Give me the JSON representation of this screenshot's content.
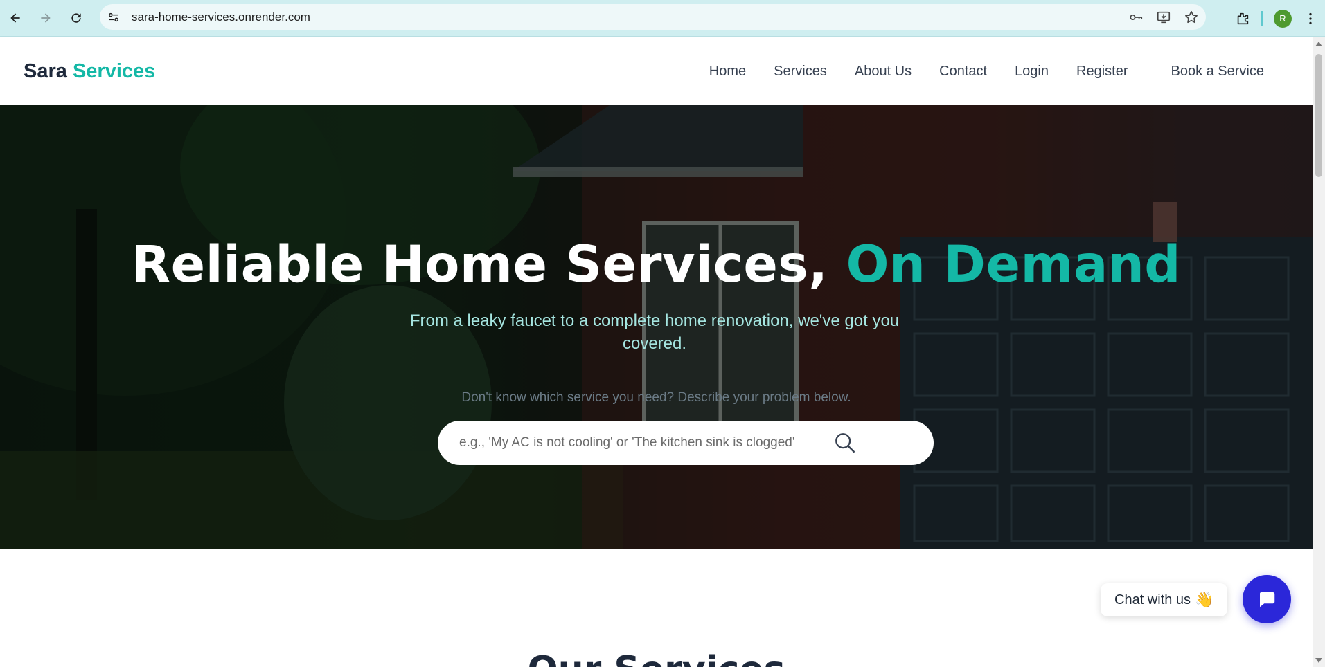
{
  "browser": {
    "url": "sara-home-services.onrender.com",
    "profile_initial": "R"
  },
  "header": {
    "logo_part1": "Sara",
    "logo_part2": "Services",
    "nav": [
      "Home",
      "Services",
      "About Us",
      "Contact",
      "Login",
      "Register"
    ],
    "cta": "Book a Service"
  },
  "hero": {
    "title_part1": "Reliable Home Services,",
    "title_part2": "On Demand",
    "subtitle": "From a leaky faucet to a complete home renovation, we've got you covered.",
    "hint": "Don't know which service you need? Describe your problem below.",
    "search_placeholder": "e.g., 'My AC is not cooling' or 'The kitchen sink is clogged'"
  },
  "section": {
    "title": "Our Services"
  },
  "chat": {
    "label": "Chat with us",
    "emoji": "👋"
  },
  "colors": {
    "accent": "#14b8a6",
    "chat_button": "#2b27d9",
    "browser_bar": "#cfeef0"
  },
  "icons": [
    "back-arrow-icon",
    "forward-arrow-icon",
    "reload-icon",
    "site-info-icon",
    "key-icon",
    "install-app-icon",
    "star-icon",
    "extensions-icon",
    "menu-dots-icon",
    "search-icon",
    "chat-bubble-icon"
  ]
}
